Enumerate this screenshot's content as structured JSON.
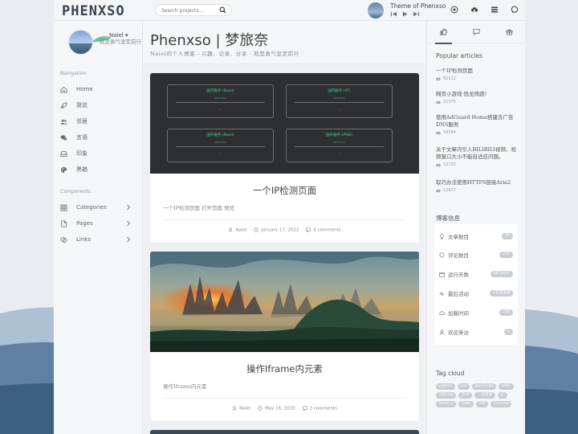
{
  "header": {
    "logo": "PHENXSO",
    "search_placeholder": "Search projects...",
    "player_title": "Theme of Phenxso"
  },
  "profile": {
    "name": "Naiel ▾",
    "motto": "就是勇气坚定前行"
  },
  "nav": {
    "section_navigation": "Navigation",
    "items": [
      {
        "label": "Home",
        "icon": "home-icon"
      },
      {
        "label": "我说",
        "icon": "feather-icon"
      },
      {
        "label": "邻居",
        "icon": "users-icon"
      },
      {
        "label": "言语",
        "icon": "chat-icon"
      },
      {
        "label": "印象",
        "icon": "inbox-icon"
      },
      {
        "label": "黑箱",
        "icon": "palette-icon"
      }
    ],
    "section_components": "Components",
    "components": [
      {
        "label": "Categories",
        "icon": "grid-icon"
      },
      {
        "label": "Pages",
        "icon": "file-icon"
      },
      {
        "label": "Links",
        "icon": "link-icon"
      }
    ]
  },
  "main": {
    "title": "Phenxso | 梦旅奈",
    "subtitle": "Naiel的个人博客 - 兴趣、记录、分享 - 就是勇气坚定前行"
  },
  "posts": [
    {
      "title": "一个IP检测页面",
      "excerpt": "一个IP检测页面 打开页面 预览",
      "author": "Naiel",
      "date": "January 17, 2022",
      "comments": "4 comments",
      "panels": [
        {
          "title": "国内服务 (Naiel)",
          "line1": "127.0.0.1",
          "line2": "---"
        },
        {
          "title": "国内服务 (IIT)",
          "line1": "127.0.0.1",
          "line2": "---"
        },
        {
          "title": "国外服务 (Naiel)",
          "line1": "127.0.0.1",
          "line2": "---"
        },
        {
          "title": "国外服务 (IPSB)",
          "line1": "127.0.0.1",
          "line2": "---"
        }
      ]
    },
    {
      "title": "操作Iframe内元素",
      "excerpt": "操作Iframe内元素",
      "author": "Naiel",
      "date": "May 16, 2020",
      "comments": "2 comments"
    }
  ],
  "right": {
    "popular_heading": "Popular articles",
    "articles": [
      {
        "title": "一个IP检测页面",
        "views": "82112"
      },
      {
        "title": "网页小游戏·恐龙快跑!",
        "views": "21375"
      },
      {
        "title": "使用AdGuard Home搭建去广告DNS服务",
        "views": "16044"
      },
      {
        "title": "关于文章内引入BILIBILI视频，视频窗口大小不能自适应问题。",
        "views": "13725"
      },
      {
        "title": "取巧办法使用HTTPS链接Aria2",
        "views": "12677"
      }
    ],
    "info_heading": "博客信息",
    "stats": [
      {
        "label": "文章数目",
        "value": "50",
        "icon": "bulb-icon"
      },
      {
        "label": "评论数目",
        "value": "276",
        "icon": "comment-icon"
      },
      {
        "label": "运行天数",
        "value": "6年184天",
        "icon": "calendar-icon"
      },
      {
        "label": "最后活动",
        "value": "1年前活动",
        "icon": "pulse-icon"
      },
      {
        "label": "加载时间",
        "value": "258",
        "icon": "cloud-icon"
      },
      {
        "label": "欢迎来访",
        "value": "1",
        "icon": "person-icon"
      }
    ],
    "tag_heading": "Tag cloud",
    "tags": [
      "python",
      "css",
      "JavaScript",
      "html",
      "VSCode",
      "PHP",
      "一些资本",
      "js",
      "Node.js",
      "Frida",
      "IDE",
      "Chrome"
    ]
  }
}
